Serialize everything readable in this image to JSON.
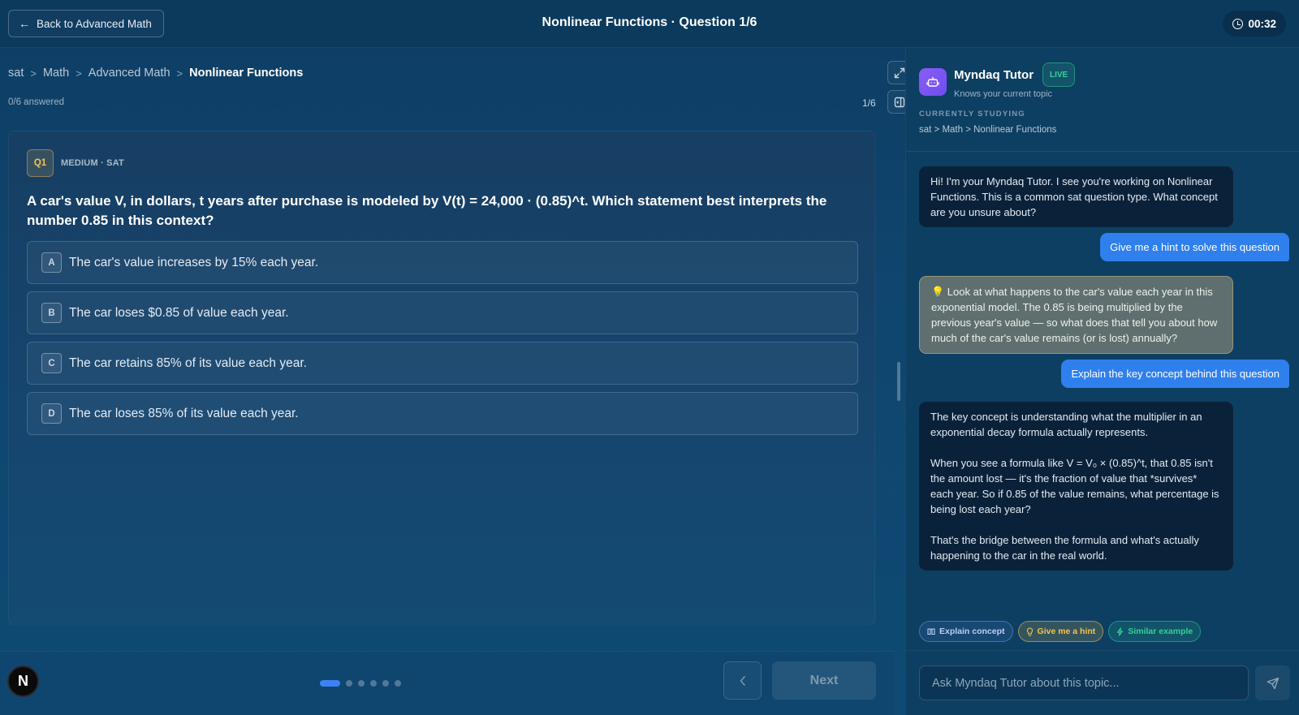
{
  "topbar": {
    "back_label": "Back to Advanced Math",
    "title": "Nonlinear Functions · Question 1/6",
    "timer": "00:32"
  },
  "breadcrumb": [
    "sat",
    "Math",
    "Advanced Math",
    "Nonlinear Functions"
  ],
  "progress": {
    "answered": "0/6 answered",
    "position": "1/6"
  },
  "question": {
    "badge": "Q1",
    "meta": "MEDIUM · SAT",
    "text": "A car's value V, in dollars, t years after purchase is modeled by V(t) = 24,000 · (0.85)^t. Which statement best interprets the number 0.85 in this context?",
    "options": [
      {
        "letter": "A",
        "text": "The car's value increases by 15% each year."
      },
      {
        "letter": "B",
        "text": "The car loses $0.85 of value each year."
      },
      {
        "letter": "C",
        "text": "The car retains 85% of its value each year."
      },
      {
        "letter": "D",
        "text": "The car loses 85% of its value each year."
      }
    ]
  },
  "nav": {
    "logo": "N",
    "next_label": "Next",
    "current_page": 1,
    "total_pages": 6
  },
  "tutor": {
    "name": "Myndaq Tutor",
    "live": "LIVE",
    "subtitle": "Knows your current topic",
    "studying_label": "CURRENTLY STUDYING",
    "studying_path": "sat > Math > Nonlinear Functions",
    "messages": {
      "m1": "Hi! I'm your Myndaq Tutor. I see you're working on Nonlinear Functions. This is a common sat question type. What concept are you unsure about?",
      "u1": "Give me a hint to solve this question",
      "m2": "💡 Look at what happens to the car's value each year in this exponential model. The 0.85 is being multiplied by the previous year's value — so what does that tell you about how much of the car's value remains (or is lost) annually?",
      "u2": "Explain the key concept behind this question",
      "m3_p1": "The key concept is understanding what the multiplier in an exponential decay formula actually represents.",
      "m3_p2": "When you see a formula like V = V₀ × (0.85)^t, that 0.85 isn't the amount lost — it's the fraction of value that *survives* each year. So if 0.85 of the value remains, what percentage is being lost each year?",
      "m3_p3": "That's the bridge between the formula and what's actually happening to the car in the real world."
    },
    "chips": [
      "Explain concept",
      "Give me a hint",
      "Similar example"
    ],
    "input_placeholder": "Ask Myndaq Tutor about this topic..."
  },
  "colors": {
    "accent": "#2f80ed",
    "live": "#34d399",
    "hint": "#f5c44f",
    "avatar": "#8b5cf6"
  }
}
